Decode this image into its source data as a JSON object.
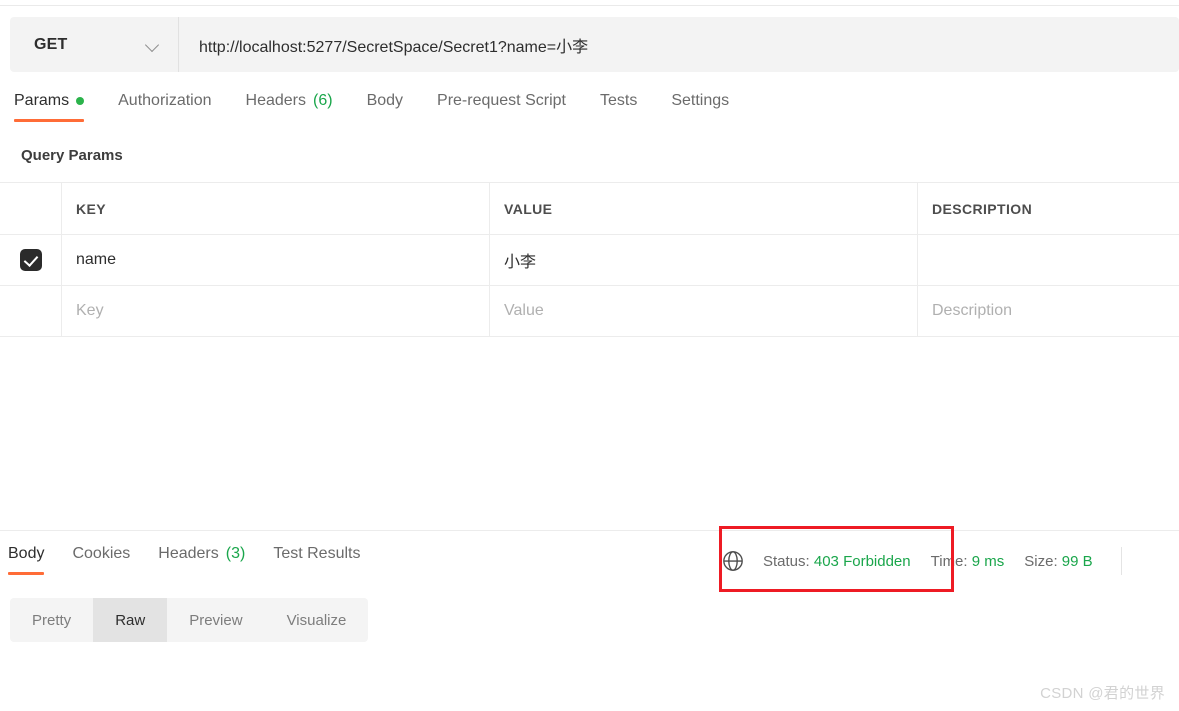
{
  "request": {
    "method": "GET",
    "method_icon": "chevron-down-icon",
    "url": "http://localhost:5277/SecretSpace/Secret1?name=小李",
    "url_placeholder": "Enter request URL"
  },
  "request_tabs": [
    {
      "label": "Params",
      "badge": "",
      "dot": true,
      "active": true
    },
    {
      "label": "Authorization",
      "badge": "",
      "dot": false,
      "active": false
    },
    {
      "label": "Headers",
      "badge": "(6)",
      "dot": false,
      "active": false
    },
    {
      "label": "Body",
      "badge": "",
      "dot": false,
      "active": false
    },
    {
      "label": "Pre-request Script",
      "badge": "",
      "dot": false,
      "active": false
    },
    {
      "label": "Tests",
      "badge": "",
      "dot": false,
      "active": false
    },
    {
      "label": "Settings",
      "badge": "",
      "dot": false,
      "active": false
    }
  ],
  "query_params": {
    "title": "Query Params",
    "columns": [
      "KEY",
      "VALUE",
      "DESCRIPTION"
    ],
    "rows": [
      {
        "checked": true,
        "key": "name",
        "value": "小李",
        "description": ""
      }
    ],
    "placeholder_row": {
      "key": "Key",
      "value": "Value",
      "description": "Description"
    }
  },
  "response_tabs": [
    {
      "label": "Body",
      "badge": "",
      "active": true
    },
    {
      "label": "Cookies",
      "badge": "",
      "active": false
    },
    {
      "label": "Headers",
      "badge": "(3)",
      "active": false
    },
    {
      "label": "Test Results",
      "badge": "",
      "active": false
    }
  ],
  "response_meta": {
    "globe_icon": "globe-icon",
    "status_label": "Status:",
    "status_value": "403 Forbidden",
    "time_label": "Time:",
    "time_value": "9 ms",
    "size_label": "Size:",
    "size_value": "99 B"
  },
  "body_formats": [
    {
      "label": "Pretty",
      "active": false
    },
    {
      "label": "Raw",
      "active": true
    },
    {
      "label": "Preview",
      "active": false
    },
    {
      "label": "Visualize",
      "active": false
    }
  ],
  "watermark": "CSDN @君的世界",
  "colors": {
    "accent": "#ff6c37",
    "success": "#1aa64b",
    "dot": "#2bb34b",
    "annotation": "#ee1b24"
  }
}
